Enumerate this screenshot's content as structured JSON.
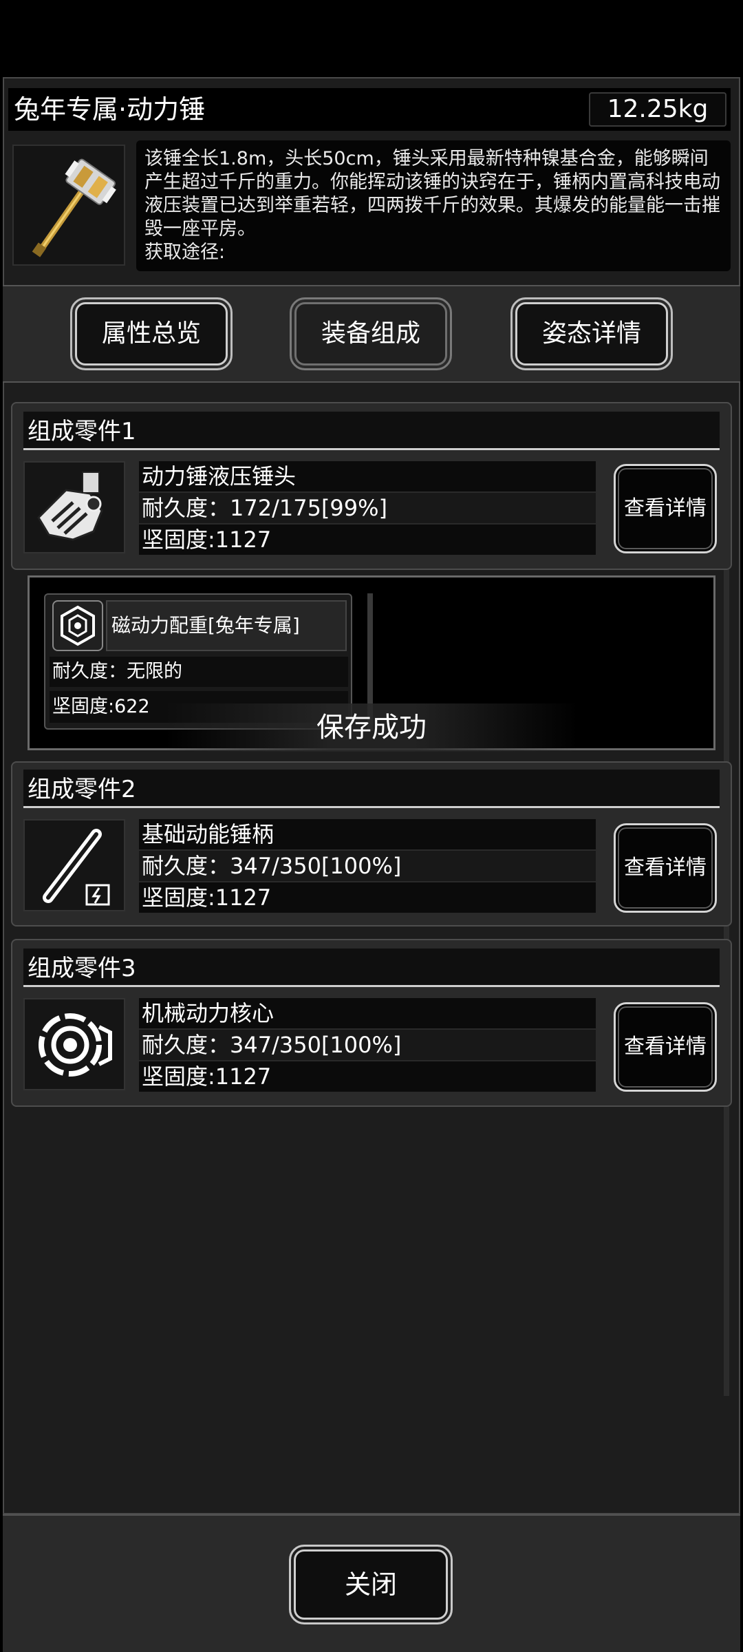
{
  "header": {
    "title": "兔年专属·动力锤",
    "weight": "12.25kg",
    "description": "该锤全长1.8m，头长50cm，锤头采用最新特种镍基合金，能够瞬间产生超过千斤的重力。你能挥动该锤的诀窍在于，锤柄内置高科技电动液压装置已达到举重若轻，四两拨千斤的效果。其爆发的能量能一击摧毁一座平房。",
    "source_label": "获取途径:"
  },
  "tabs": [
    {
      "label": "属性总览",
      "active": false
    },
    {
      "label": "装备组成",
      "active": true
    },
    {
      "label": "姿态详情",
      "active": false
    }
  ],
  "parts": [
    {
      "header": "组成零件1",
      "name": "动力锤液压锤头",
      "durability": "耐久度：172/175[99%]",
      "hardness": "坚固度:1127",
      "detail_label": "查看详情",
      "icon": "hammer-head-icon"
    },
    {
      "header": "组成零件2",
      "name": "基础动能锤柄",
      "durability": "耐久度：347/350[100%]",
      "hardness": "坚固度:1127",
      "detail_label": "查看详情",
      "icon": "hammer-handle-icon"
    },
    {
      "header": "组成零件3",
      "name": "机械动力核心",
      "durability": "耐久度：347/350[100%]",
      "hardness": "坚固度:1127",
      "detail_label": "查看详情",
      "icon": "mechanical-core-icon"
    }
  ],
  "sub_component": {
    "name": "磁动力配重[兔年专属]",
    "durability": "耐久度：无限的",
    "hardness": "坚固度:622",
    "icon": "hex-nut-icon"
  },
  "toast": "保存成功",
  "footer": {
    "close_label": "关闭"
  },
  "colors": {
    "background": "#000000",
    "panel": "#1d1d1d",
    "card": "#2a2a2a",
    "text": "#ffffff"
  }
}
